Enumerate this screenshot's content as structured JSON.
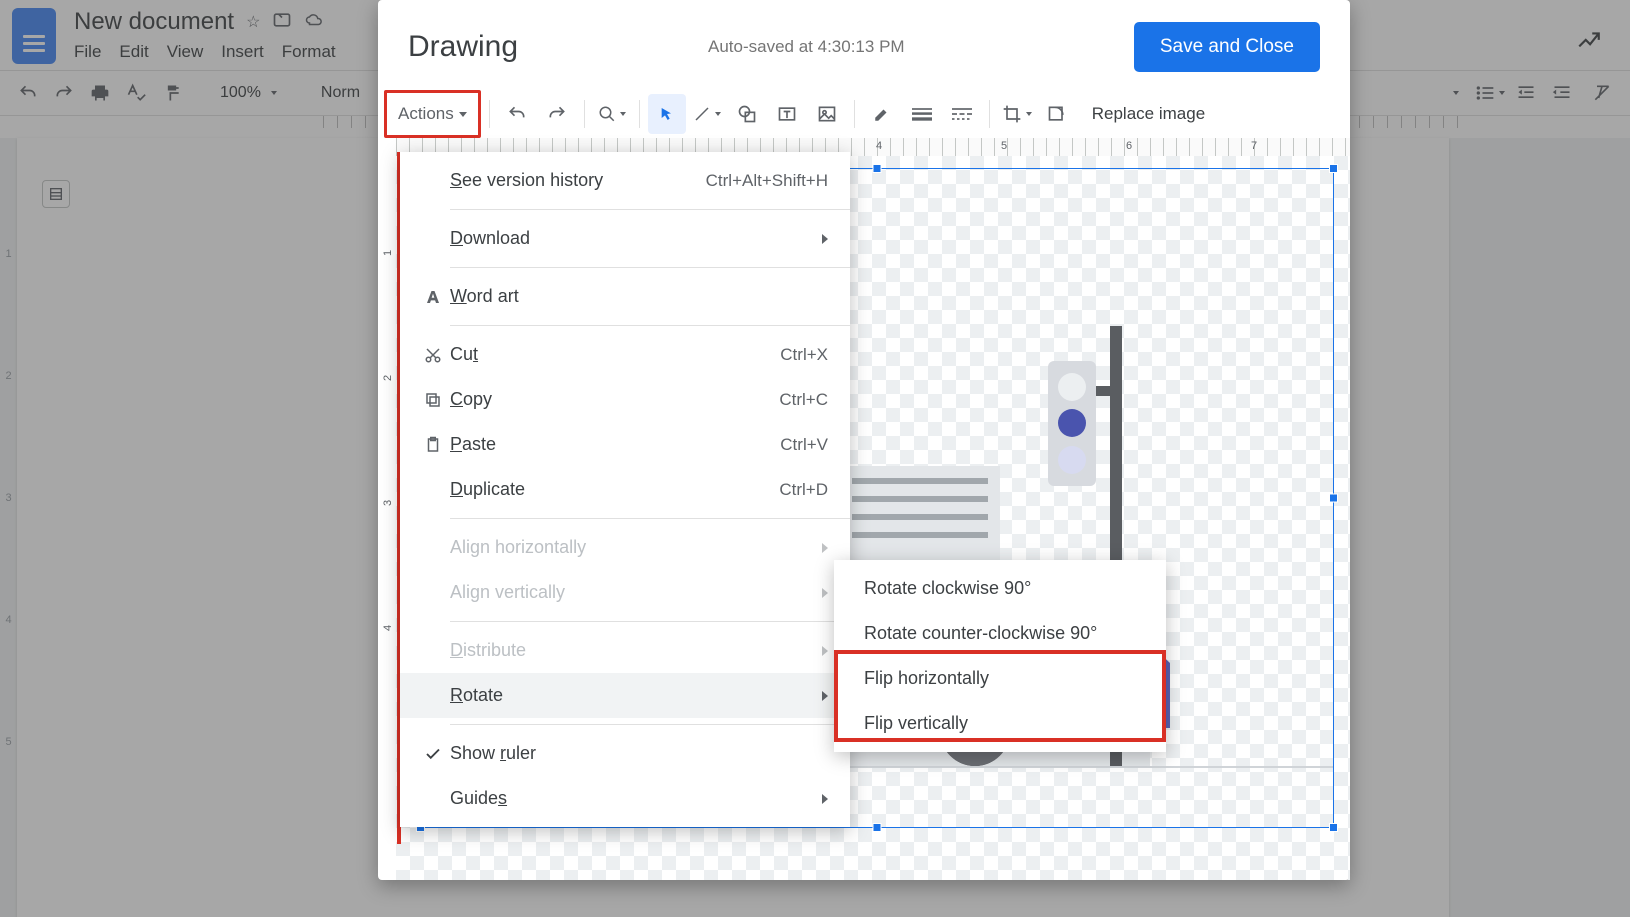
{
  "docs": {
    "title": "New document",
    "menubar": [
      "File",
      "Edit",
      "View",
      "Insert",
      "Format"
    ],
    "zoom": "100%",
    "style_name": "Norm"
  },
  "drawing": {
    "title": "Drawing",
    "status": "Auto-saved at 4:30:13 PM",
    "save_close": "Save and Close",
    "actions_label": "Actions",
    "replace_image": "Replace image",
    "hruler": [
      "4",
      "5",
      "6",
      "7"
    ],
    "vruler": [
      "1",
      "2",
      "3",
      "4"
    ]
  },
  "actions_menu": {
    "version_history": {
      "label": "See version history",
      "shortcut": "Ctrl+Alt+Shift+H"
    },
    "download": {
      "label": "Download"
    },
    "word_art": {
      "label": "Word art"
    },
    "cut": {
      "label": "Cut",
      "shortcut": "Ctrl+X"
    },
    "copy": {
      "label": "Copy",
      "shortcut": "Ctrl+C"
    },
    "paste": {
      "label": "Paste",
      "shortcut": "Ctrl+V"
    },
    "duplicate": {
      "label": "Duplicate",
      "shortcut": "Ctrl+D"
    },
    "align_h": {
      "label": "Align horizontally"
    },
    "align_v": {
      "label": "Align vertically"
    },
    "distribute": {
      "label": "Distribute"
    },
    "rotate": {
      "label": "Rotate"
    },
    "show_ruler": {
      "label": "Show ruler"
    },
    "guides": {
      "label": "Guides"
    }
  },
  "rotate_submenu": {
    "cw": "Rotate clockwise 90°",
    "ccw": "Rotate counter-clockwise 90°",
    "flip_h": "Flip horizontally",
    "flip_v": "Flip vertically"
  }
}
